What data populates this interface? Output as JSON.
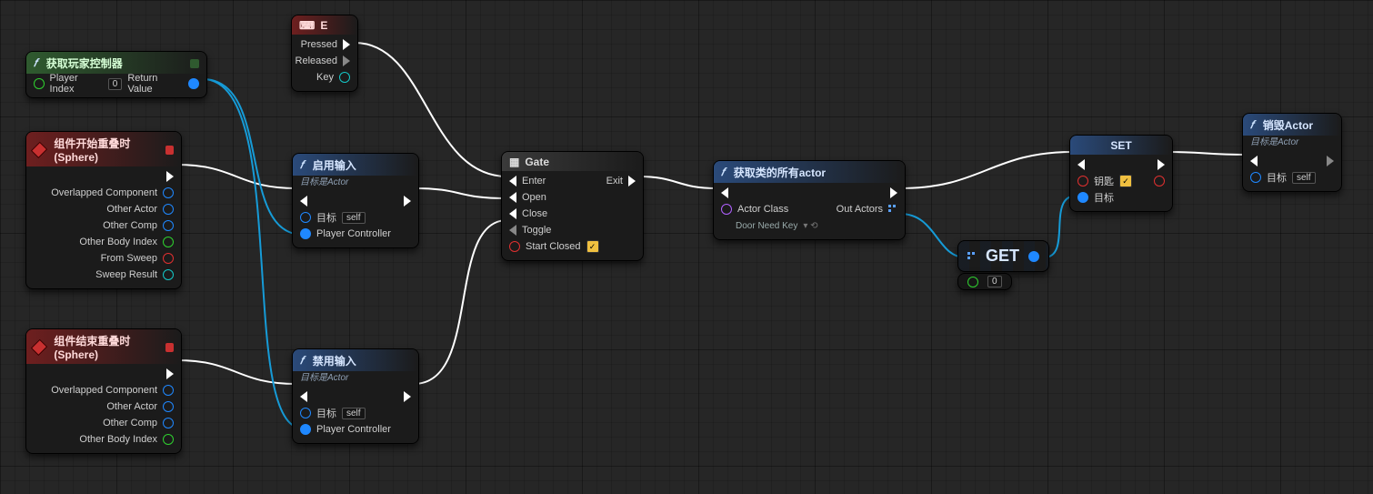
{
  "nodes": {
    "getPlayerController": {
      "title": "获取玩家控制器",
      "pins": {
        "playerIndex": "Player Index",
        "playerIndexVal": "0",
        "returnValue": "Return Value"
      }
    },
    "inputE": {
      "title": "E",
      "pins": {
        "pressed": "Pressed",
        "released": "Released",
        "key": "Key"
      }
    },
    "beginOverlap": {
      "title": "组件开始重叠时 (Sphere)",
      "pins": {
        "overlappedComponent": "Overlapped Component",
        "otherActor": "Other Actor",
        "otherComp": "Other Comp",
        "otherBodyIndex": "Other Body Index",
        "fromSweep": "From Sweep",
        "sweepResult": "Sweep Result"
      }
    },
    "endOverlap": {
      "title": "组件结束重叠时 (Sphere)",
      "pins": {
        "overlappedComponent": "Overlapped Component",
        "otherActor": "Other Actor",
        "otherComp": "Other Comp",
        "otherBodyIndex": "Other Body Index"
      }
    },
    "enableInput": {
      "title": "启用输入",
      "subtitle": "目标是Actor",
      "pins": {
        "target": "目标",
        "targetVal": "self",
        "playerController": "Player Controller"
      }
    },
    "disableInput": {
      "title": "禁用输入",
      "subtitle": "目标是Actor",
      "pins": {
        "target": "目标",
        "targetVal": "self",
        "playerController": "Player Controller"
      }
    },
    "gate": {
      "title": "Gate",
      "pins": {
        "enter": "Enter",
        "open": "Open",
        "close": "Close",
        "toggle": "Toggle",
        "startClosed": "Start Closed",
        "exit": "Exit"
      }
    },
    "getAllActors": {
      "title": "获取类的所有actor",
      "pins": {
        "actorClass": "Actor Class",
        "actorClassVal": "Door Need Key",
        "outActors": "Out Actors"
      }
    },
    "get": {
      "title": "GET",
      "indexVal": "0"
    },
    "set": {
      "title": "SET",
      "pins": {
        "key": "钥匙",
        "target": "目标"
      }
    },
    "destroy": {
      "title": "销毁Actor",
      "subtitle": "目标是Actor",
      "pins": {
        "target": "目标",
        "targetVal": "self"
      }
    }
  }
}
